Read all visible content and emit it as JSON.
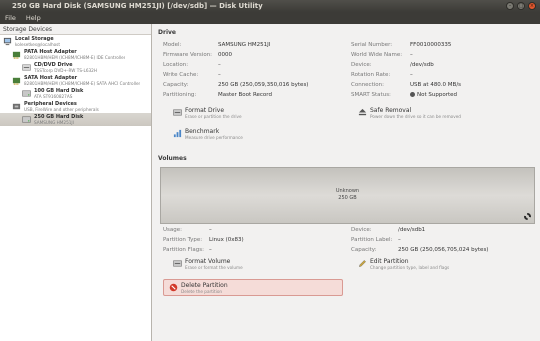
{
  "window": {
    "title": "250 GB Hard Disk (SAMSUNG HM251JI) [/dev/sdb] — Disk Utility"
  },
  "menu": [
    "File",
    "Help"
  ],
  "sidebar": {
    "header": "Storage Devices",
    "items": [
      {
        "name": "Local Storage",
        "sub": "kolesetkes@localhost",
        "icon": "computer-icon"
      },
      {
        "name": "PATA Host Adapter",
        "sub": "82801HBM/HEM (ICH8M/ICH8M-E) IDE Controller",
        "icon": "adapter-icon"
      },
      {
        "name": "CD/DVD Drive",
        "sub": "TSSTcorp DVD+-RW TS-L632H",
        "icon": "optical-drive-icon"
      },
      {
        "name": "SATA Host Adapter",
        "sub": "82801HBM/HEM (ICH8M/ICH8M-E) SATA AHCI Controller",
        "icon": "adapter-icon"
      },
      {
        "name": "100 GB Hard Disk",
        "sub": "ATA ST9160827AS",
        "icon": "hard-disk-icon"
      },
      {
        "name": "Peripheral Devices",
        "sub": "USB, FireWire and other peripherals",
        "icon": "peripheral-icon"
      },
      {
        "name": "250 GB Hard Disk",
        "sub": "SAMSUNG HM251JI",
        "icon": "hard-disk-icon"
      }
    ]
  },
  "drive": {
    "title": "Drive",
    "left": [
      {
        "k": "Model:",
        "v": "SAMSUNG HM251JI"
      },
      {
        "k": "Firmware Version:",
        "v": "0000"
      },
      {
        "k": "Location:",
        "v": "–"
      },
      {
        "k": "Write Cache:",
        "v": "–"
      },
      {
        "k": "Capacity:",
        "v": "250 GB (250,059,350,016 bytes)"
      },
      {
        "k": "Partitioning:",
        "v": "Master Boot Record"
      }
    ],
    "right": [
      {
        "k": "Serial Number:",
        "v": "FF0010000335"
      },
      {
        "k": "World Wide Name:",
        "v": "–"
      },
      {
        "k": "Device:",
        "v": "/dev/sdb"
      },
      {
        "k": "Rotation Rate:",
        "v": "–"
      },
      {
        "k": "Connection:",
        "v": "USB at 480.0 MB/s"
      },
      {
        "k": "SMART Status:",
        "v": "Not Supported"
      }
    ],
    "actions": {
      "format": {
        "label": "Format Drive",
        "desc": "Erase or partition the drive"
      },
      "safe_removal": {
        "label": "Safe Removal",
        "desc": "Power down the drive so it can be removed"
      },
      "benchmark": {
        "label": "Benchmark",
        "desc": "Measure drive performance"
      }
    }
  },
  "volumes": {
    "title": "Volumes",
    "bar": {
      "label": "Unknown",
      "size": "250 GB"
    },
    "left": [
      {
        "k": "Usage:",
        "v": "–"
      },
      {
        "k": "Partition Type:",
        "v": "Linux (0x83)"
      },
      {
        "k": "Partition Flags:",
        "v": "–"
      }
    ],
    "right": [
      {
        "k": "Device:",
        "v": "/dev/sdb1"
      },
      {
        "k": "Partition Label:",
        "v": "–"
      },
      {
        "k": "Capacity:",
        "v": "250 GB (250,056,705,024 bytes)"
      }
    ],
    "actions": {
      "format_volume": {
        "label": "Format Volume",
        "desc": "Erase or format the volume"
      },
      "edit_partition": {
        "label": "Edit Partition",
        "desc": "Change partition type, label and flags"
      },
      "delete_partition": {
        "label": "Delete Partition",
        "desc": "Delete the partition"
      }
    }
  }
}
